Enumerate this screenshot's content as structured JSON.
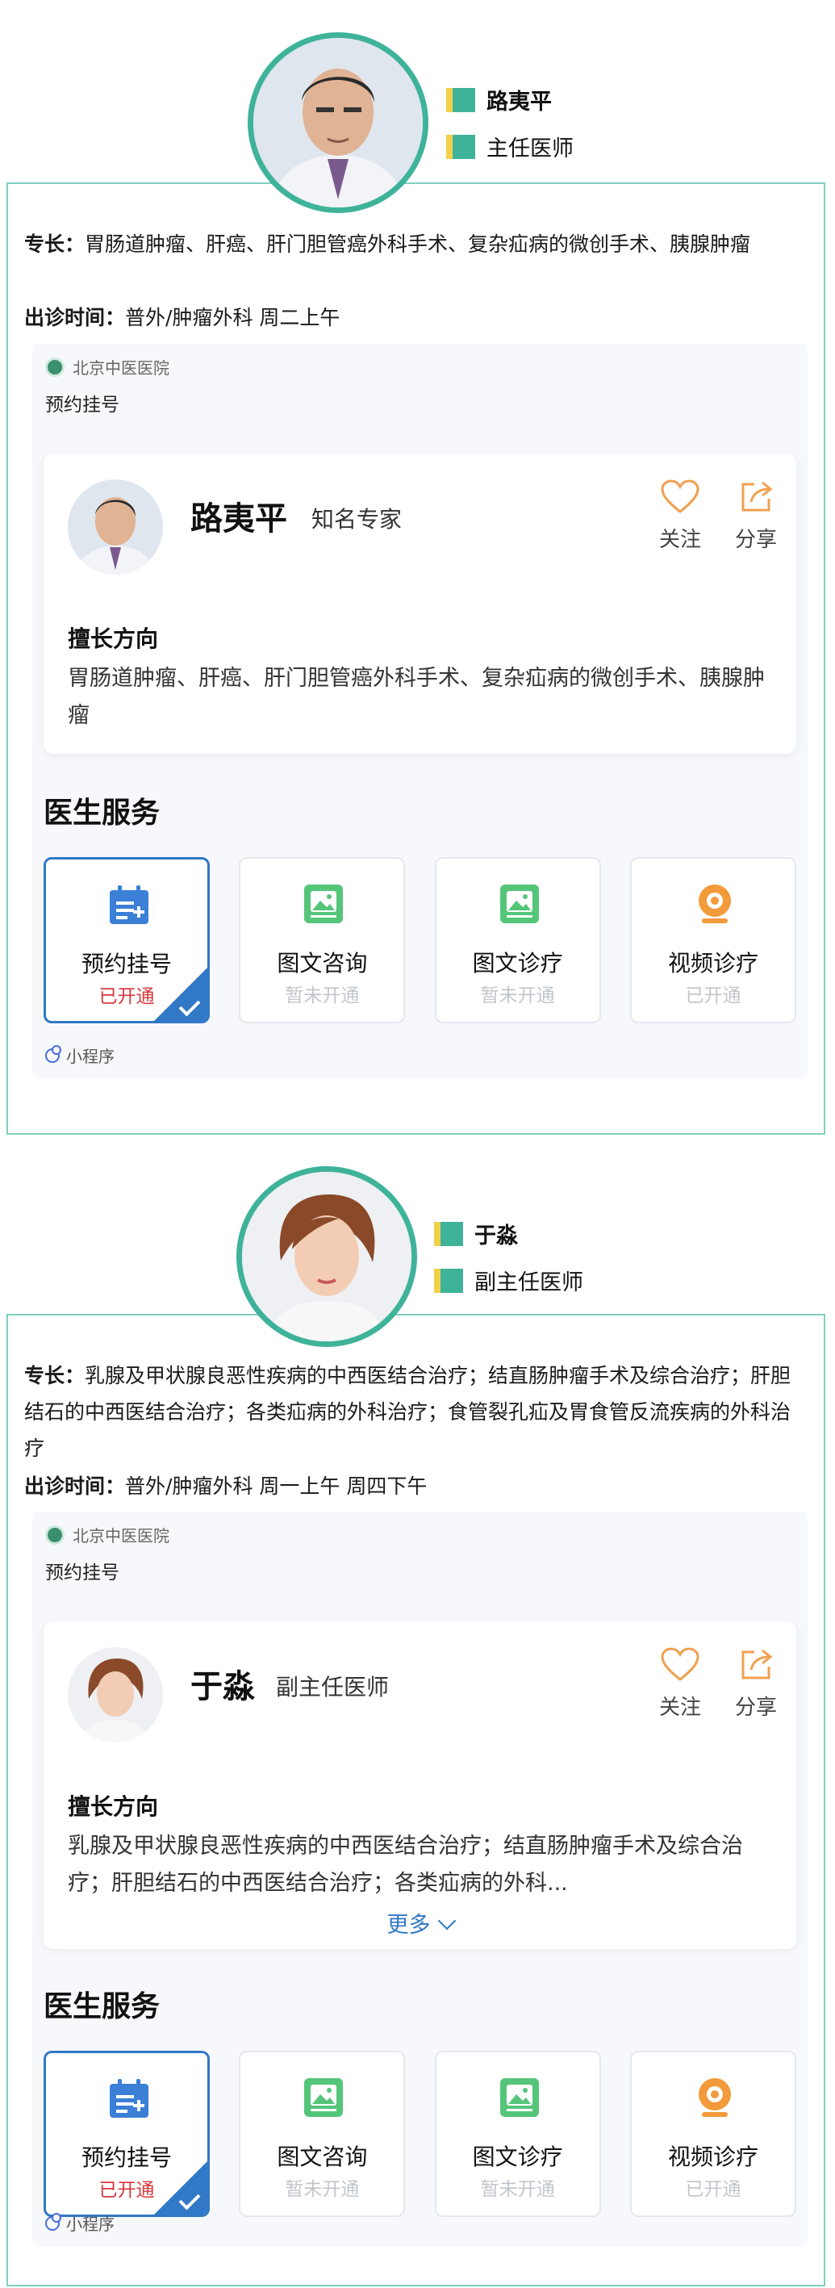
{
  "doctors": [
    {
      "name": "路夷平",
      "rank": "主任医师",
      "specialty_label": "专长：",
      "specialty": "胃肠道肿瘤、肝癌、肝门胆管癌外科手术、复杂疝病的微创手术、胰腺肿瘤",
      "hours_label": "出诊时间：",
      "hours": "普外/肿瘤外科 周二上午",
      "mini": {
        "hospital": "北京中医医院",
        "booking": "预约挂号",
        "card_name": "路夷平",
        "card_title": "知名专家",
        "follow": "关注",
        "share": "分享",
        "good_title": "擅长方向",
        "good_text": "胃肠道肿瘤、肝癌、肝门胆管癌外科手术、复杂疝病的微创手术、胰腺肿瘤",
        "more": "",
        "services_title": "医生服务",
        "services": [
          {
            "name": "预约挂号",
            "status": "已开通",
            "icon": "calendar-icon"
          },
          {
            "name": "图文咨询",
            "status": "暂未开通",
            "icon": "image-icon"
          },
          {
            "name": "图文诊疗",
            "status": "暂未开通",
            "icon": "image-icon"
          },
          {
            "name": "视频诊疗",
            "status": "已开通",
            "icon": "camera-icon"
          }
        ],
        "footer": "小程序"
      }
    },
    {
      "name": "于淼",
      "rank": "副主任医师",
      "specialty_label": "专长：",
      "specialty": "乳腺及甲状腺良恶性疾病的中西医结合治疗；结直肠肿瘤手术及综合治疗；肝胆结石的中西医结合治疗；各类疝病的外科治疗；食管裂孔疝及胃食管反流疾病的外科治疗",
      "hours_label": "出诊时间：",
      "hours": "普外/肿瘤外科 周一上午 周四下午",
      "mini": {
        "hospital": "北京中医医院",
        "booking": "预约挂号",
        "card_name": "于淼",
        "card_title": "副主任医师",
        "follow": "关注",
        "share": "分享",
        "good_title": "擅长方向",
        "good_text": "乳腺及甲状腺良恶性疾病的中西医结合治疗；结直肠肿瘤手术及综合治疗；肝胆结石的中西医结合治疗；各类疝病的外科...",
        "more": "更多",
        "services_title": "医生服务",
        "services": [
          {
            "name": "预约挂号",
            "status": "已开通",
            "icon": "calendar-icon"
          },
          {
            "name": "图文咨询",
            "status": "暂未开通",
            "icon": "image-icon"
          },
          {
            "name": "图文诊疗",
            "status": "暂未开通",
            "icon": "image-icon"
          },
          {
            "name": "视频诊疗",
            "status": "已开通",
            "icon": "camera-icon"
          }
        ],
        "footer": "小程序"
      }
    }
  ],
  "colors": {
    "accent_green": "#3fb39a",
    "accent_yellow": "#f2d04a",
    "brand_blue": "#3178c6",
    "status_red": "#d6373b",
    "heart_orange": "#f0a050"
  }
}
